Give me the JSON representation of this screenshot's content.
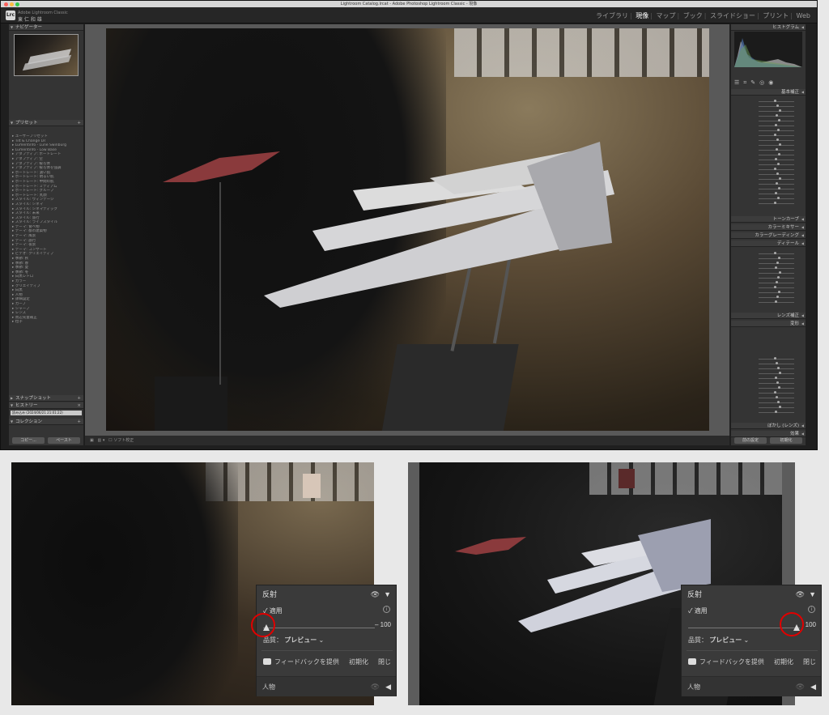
{
  "window": {
    "title": "Lightroom Catalog.lrcat - Adobe Photoshop Lightroom Classic - 現像",
    "badge": "Lrc",
    "user_small": "Adobe Lightroom Classic",
    "user_name": "東 仁 和 雄"
  },
  "modules": [
    "ライブラリ",
    "現像",
    "マップ",
    "ブック",
    "スライドショー",
    "プリント",
    "Web"
  ],
  "active_module": "現像",
  "left_panel": {
    "navigator": "ナビゲーター",
    "presets": "プリセット",
    "snapshots": "スナップショット",
    "history": "ヒストリー",
    "collections": "コレクション",
    "preset_items": [
      "ユーザープリセット",
      "Tilt & Change LR",
      "Lumentinfo - Lune Swinburg",
      "Lumentinfo - Low Base",
      "アダプティブ: ポートレート",
      "アダプティブ: 空",
      "アダプティブ: 被写体",
      "アダプティブ: 被写体を強調",
      "ポートレート: 濃い肌",
      "ポートレート: 明るい肌",
      "ポートレート: 中間の肌",
      "ポートレート: ミディアム",
      "ポートレート: グループ",
      "ポートレート: 丸顔",
      "スタイル: ヴィンテージ",
      "スタイル: シネマ",
      "スタイル: シネマティック",
      "スタイル: 未来",
      "スタイル: 旅行",
      "スタイル: ライフスタイル",
      "テーマ: 食べ物",
      "テーマ: 都市建築物",
      "テーマ: 風景",
      "テーマ: 旅行",
      "テーマ: 夜景",
      "テーマ: コンサート",
      "ビデオ: クリエイティブ",
      "季節: 秋",
      "季節: 春",
      "季節: 夏",
      "季節: 冬",
      "白黒レトロ",
      "カラー",
      "クリエイティブ",
      "白黒",
      "人物",
      "詳細設定",
      "カーブ",
      "シャープ",
      "レンズ",
      "周辺光量補正",
      "粒子"
    ],
    "history_item": "読み込み (2024/06/21 21:01:22)",
    "copy_button": "コピー...",
    "paste_button": "ペースト"
  },
  "toolbar": {
    "soft_proof": "ソフト校正"
  },
  "right_panel": {
    "histogram": "ヒストグラム",
    "basic": "基本補正",
    "tone_curve": "トーンカーブ",
    "color_mixer": "カラーミキサー",
    "color_grading": "カラーグレーディング",
    "detail": "ディテール",
    "lens": "レンズ補正",
    "transform": "変形",
    "blur": "ぼかし (レンズ)",
    "calibration": "効果",
    "prev_button": "前の設定",
    "reset_button": "初期化"
  },
  "popover_left": {
    "title": "反射",
    "apply_label": "適用",
    "value": "– 100",
    "quality_label": "品質：",
    "quality_value": "プレビュー",
    "feedback": "フィードバックを提供",
    "reset": "初期化",
    "close": "閉じる",
    "people": "人物",
    "slider_position": 0
  },
  "popover_right": {
    "title": "反射",
    "apply_label": "適用",
    "value": "100",
    "quality_label": "品質：",
    "quality_value": "プレビュー",
    "feedback": "フィードバックを提供",
    "reset": "初期化",
    "close": "閉じる",
    "people": "人物",
    "slider_position": 1
  },
  "colors": {
    "panel_bg": "#343434",
    "popover_bg": "#3a3a3a",
    "highlight_circle": "#e00000"
  }
}
